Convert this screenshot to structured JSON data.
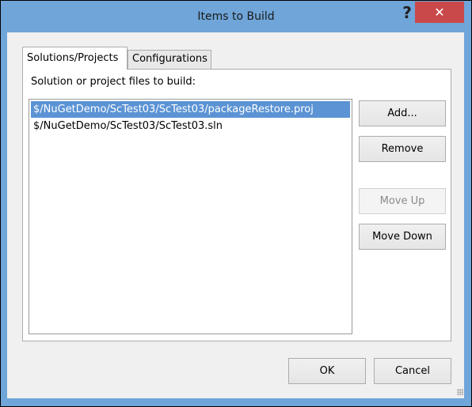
{
  "window": {
    "title": "Items to Build",
    "help_label": "?",
    "close_label": "✕"
  },
  "tabs": [
    {
      "label": "Solutions/Projects",
      "active": true
    },
    {
      "label": "Configurations",
      "active": false
    }
  ],
  "panel": {
    "label": "Solution or project files to build:",
    "files": [
      "$/NuGetDemo/ScTest03/ScTest03/packageRestore.proj",
      "$/NuGetDemo/ScTest03/ScTest03.sln"
    ],
    "selected_index": 0
  },
  "buttons": {
    "add": "Add...",
    "remove": "Remove",
    "move_up": "Move Up",
    "move_down": "Move Down",
    "ok": "OK",
    "cancel": "Cancel"
  },
  "colors": {
    "titlebar": "#6fa5d8",
    "close": "#c9494b",
    "selection": "#5b93d4"
  }
}
